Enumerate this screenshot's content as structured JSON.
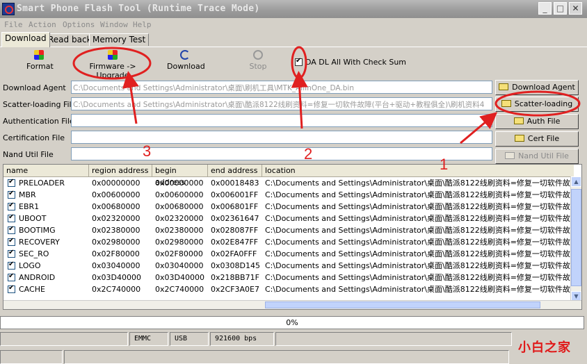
{
  "window": {
    "title": "Smart Phone Flash Tool (Runtime Trace Mode)",
    "buttons": {
      "minimize": "_",
      "maximize": "□",
      "close": "✕"
    }
  },
  "menu": [
    "File",
    "Action",
    "Options",
    "Window",
    "Help"
  ],
  "tabs": [
    "Download",
    "Read back",
    "Memory Test"
  ],
  "toolbar": {
    "format": "Format",
    "firmware_upgrade": "Firmware -> Upgrade",
    "download": "Download",
    "stop": "Stop"
  },
  "checksum_label": "DA DL All With Check Sum",
  "form": {
    "download_agent": {
      "label": "Download Agent",
      "value": "C:\\Documents and Settings\\Administrator\\桌面\\刷机工具\\MTK_AllInOne_DA.bin"
    },
    "scatter_loading": {
      "label": "Scatter-loading File",
      "value": "C:\\Documents and Settings\\Administrator\\桌面\\酷派8122线刷资料=修复一切软件故障(平台+驱动+教程俱全)\\刷机资料4"
    },
    "authentication": {
      "label": "Authentication File",
      "value": ""
    },
    "certification": {
      "label": "Certification File",
      "value": ""
    },
    "nand_util": {
      "label": "Nand Util File",
      "value": ""
    }
  },
  "side_buttons": [
    "Download Agent",
    "Scatter-loading",
    "Auth File",
    "Cert File",
    "Nand Util File"
  ],
  "table": {
    "headers": [
      "name",
      "region address",
      "begin address",
      "end address",
      "location"
    ],
    "rows": [
      [
        "PRELOADER",
        "0x00000000",
        "0x00000000",
        "0x00018483",
        "C:\\Documents and Settings\\Administrator\\桌面\\酷派8122线刷资料=修复一切软件故障("
      ],
      [
        "MBR",
        "0x00600000",
        "0x00600000",
        "0x006001FF",
        "C:\\Documents and Settings\\Administrator\\桌面\\酷派8122线刷资料=修复一切软件故障("
      ],
      [
        "EBR1",
        "0x00680000",
        "0x00680000",
        "0x006801FF",
        "C:\\Documents and Settings\\Administrator\\桌面\\酷派8122线刷资料=修复一切软件故障("
      ],
      [
        "UBOOT",
        "0x02320000",
        "0x02320000",
        "0x02361647",
        "C:\\Documents and Settings\\Administrator\\桌面\\酷派8122线刷资料=修复一切软件故障("
      ],
      [
        "BOOTIMG",
        "0x02380000",
        "0x02380000",
        "0x028087FF",
        "C:\\Documents and Settings\\Administrator\\桌面\\酷派8122线刷资料=修复一切软件故障("
      ],
      [
        "RECOVERY",
        "0x02980000",
        "0x02980000",
        "0x02E847FF",
        "C:\\Documents and Settings\\Administrator\\桌面\\酷派8122线刷资料=修复一切软件故障("
      ],
      [
        "SEC_RO",
        "0x02F80000",
        "0x02F80000",
        "0x02FA0FFF",
        "C:\\Documents and Settings\\Administrator\\桌面\\酷派8122线刷资料=修复一切软件故障("
      ],
      [
        "LOGO",
        "0x03040000",
        "0x03040000",
        "0x0308D145",
        "C:\\Documents and Settings\\Administrator\\桌面\\酷派8122线刷资料=修复一切软件故障("
      ],
      [
        "ANDROID",
        "0x03D40000",
        "0x03D40000",
        "0x218BB71F",
        "C:\\Documents and Settings\\Administrator\\桌面\\酷派8122线刷资料=修复一切软件故障("
      ],
      [
        "CACHE",
        "0x2C740000",
        "0x2C740000",
        "0x2CF3A0E7",
        "C:\\Documents and Settings\\Administrator\\桌面\\酷派8122线刷资料=修复一切软件故障("
      ]
    ]
  },
  "progress": {
    "text": "0%",
    "fraction": 0
  },
  "statusbar": [
    "EMMC",
    "USB",
    "921600 bps"
  ],
  "watermark": "小白之家",
  "annotations": [
    "1",
    "2",
    "3"
  ],
  "colors": {
    "annotation": "#e02020",
    "titlebar": "#9a9a9a"
  }
}
